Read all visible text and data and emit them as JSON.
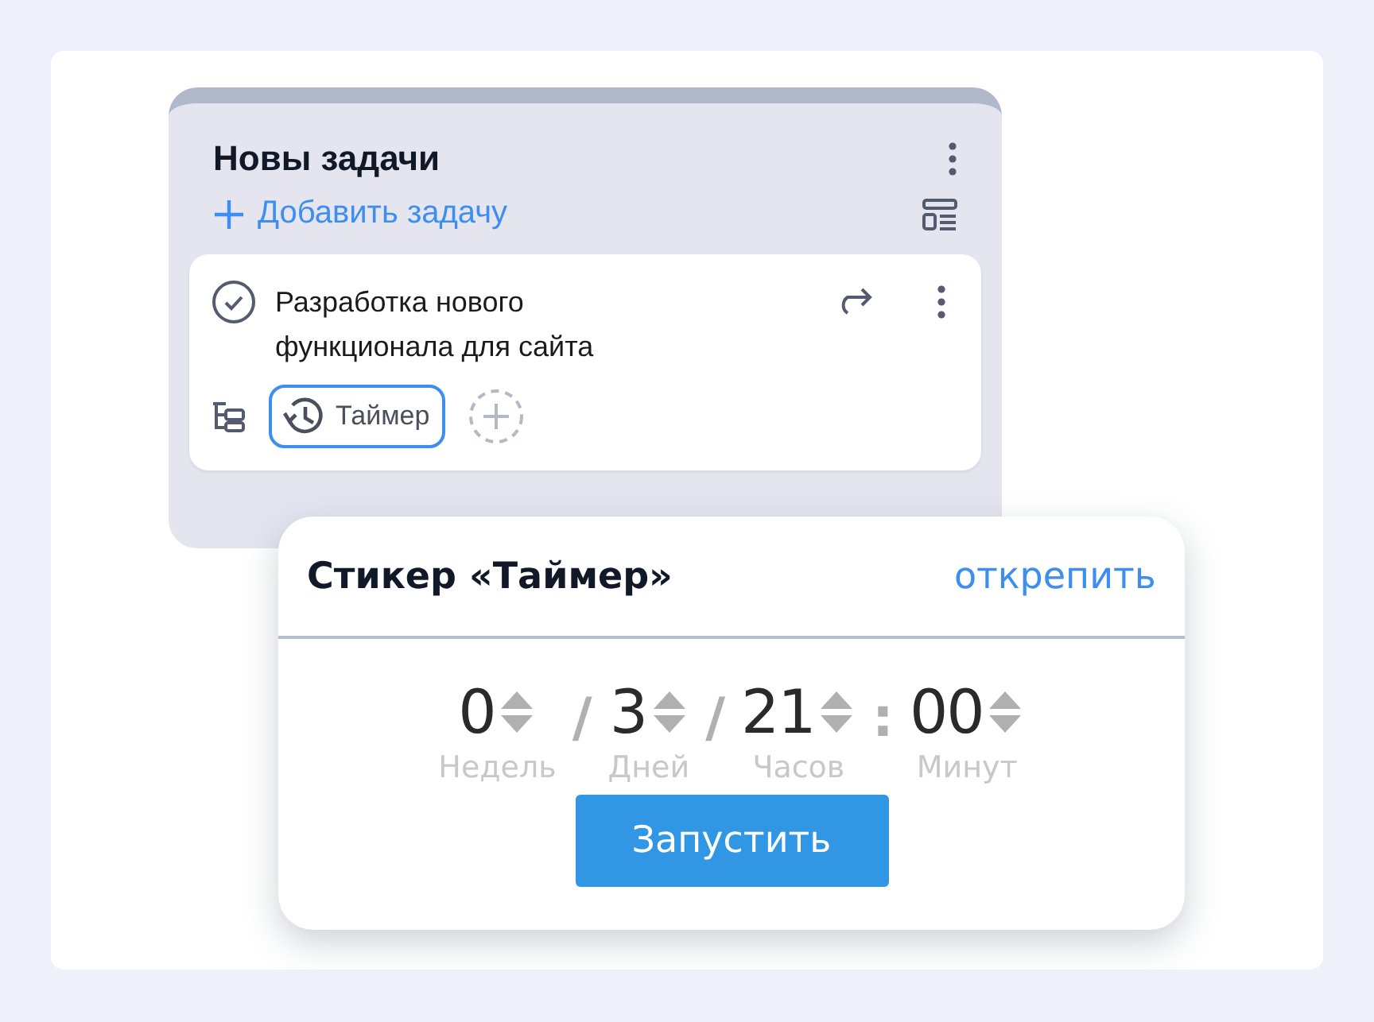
{
  "column": {
    "title": "Новы задачи",
    "add_label": "Добавить задачу",
    "tasks": [
      {
        "title": "Разработка нового функционала для сайта",
        "sticker": {
          "label": "Таймер",
          "selected": true
        }
      }
    ]
  },
  "popup": {
    "title": "Стикер «Таймер»",
    "unpin": "открепить",
    "units": [
      {
        "value": "0",
        "label": "Недель",
        "separator": "/"
      },
      {
        "value": "3",
        "label": "Дней",
        "separator": "/"
      },
      {
        "value": "21",
        "label": "Часов",
        "separator": ":"
      },
      {
        "value": "00",
        "label": "Минут"
      }
    ],
    "start": "Запустить"
  }
}
